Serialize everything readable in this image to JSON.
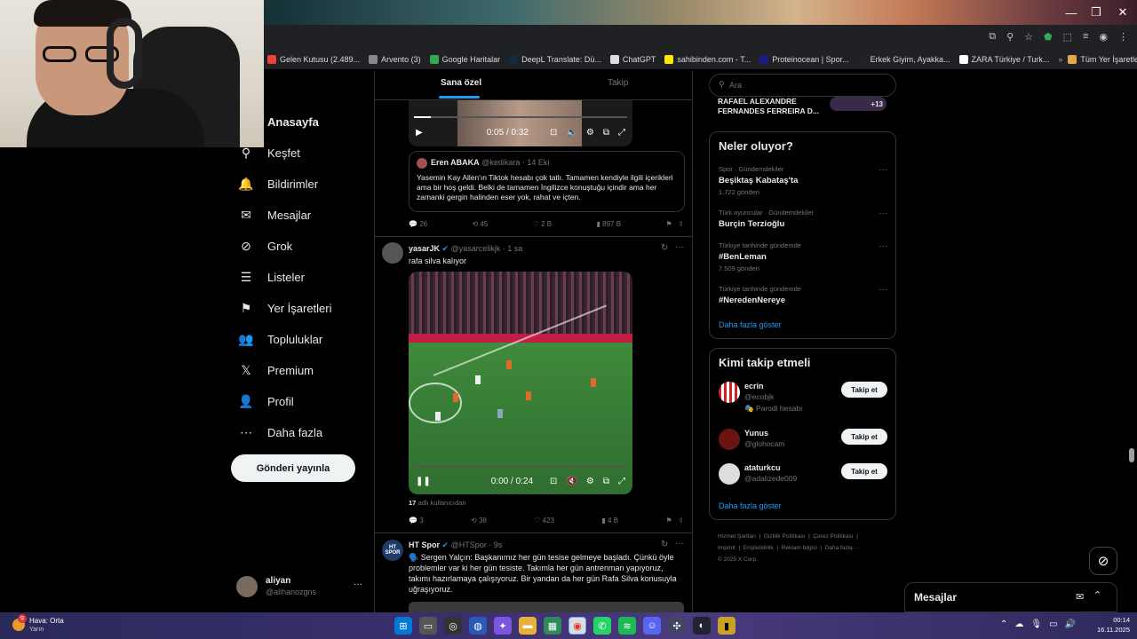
{
  "window": {
    "min": "—",
    "restore": "❐",
    "close": "✕"
  },
  "bookmarks": [
    {
      "label": "Gelen Kutusu (2.489...",
      "color": "#ea4335"
    },
    {
      "label": "Arvento (3)",
      "color": "#888888"
    },
    {
      "label": "Google Haritalar",
      "color": "#34a853"
    },
    {
      "label": "DeepL Translate: Dü...",
      "color": "#0f2b46"
    },
    {
      "label": "ChatGPT",
      "color": "#dddddd"
    },
    {
      "label": "sahibinden.com - T...",
      "color": "#ffe800"
    },
    {
      "label": "Proteinocean | Spor...",
      "color": "#1a1a80"
    },
    {
      "label": "Erkek Giyim, Ayakka...",
      "color": "#222222"
    },
    {
      "label": "ZARA Türkiye / Turk...",
      "color": "#ffffff"
    }
  ],
  "bookmarks_all": "Tüm Yer İşaretleri",
  "nav": {
    "items": [
      {
        "label": "Anasayfa",
        "icon": "home-icon",
        "glyph": "⌂"
      },
      {
        "label": "Keşfet",
        "icon": "search-icon",
        "glyph": "⚲"
      },
      {
        "label": "Bildirimler",
        "icon": "bell-icon",
        "glyph": "🔔"
      },
      {
        "label": "Mesajlar",
        "icon": "mail-icon",
        "glyph": "✉"
      },
      {
        "label": "Grok",
        "icon": "grok-icon",
        "glyph": "⊘"
      },
      {
        "label": "Listeler",
        "icon": "list-icon",
        "glyph": "☰"
      },
      {
        "label": "Yer İşaretleri",
        "icon": "bookmark-icon",
        "glyph": "⚑"
      },
      {
        "label": "Topluluklar",
        "icon": "communities-icon",
        "glyph": "👥"
      },
      {
        "label": "Premium",
        "icon": "x-logo-icon",
        "glyph": "𝕏"
      },
      {
        "label": "Profil",
        "icon": "person-icon",
        "glyph": "👤"
      },
      {
        "label": "Daha fazla",
        "icon": "more-icon",
        "glyph": "⋯"
      }
    ],
    "post_button": "Gönderi yayınla",
    "account": {
      "name": "aliyan",
      "handle": "@alihanozgns",
      "more": "···"
    }
  },
  "feed": {
    "tabs": [
      "Sana özel",
      "Takip"
    ],
    "post1": {
      "video_time": "0:05 / 0:32",
      "quote": {
        "name": "Eren ABAKA",
        "handle": "@kedikara",
        "time": "· 14 Eki",
        "text": "Yasemin Kay Allen'ın Tiktok hesabı çok tatlı. Tamamen kendiyle ilgili içerikleri ama bir hoş geldi. Belki de tamamen İngilizce konuştuğu içindir ama her zamanki gergin halinden eser yok, rahat ve içten."
      },
      "actions": {
        "replies": "26",
        "reposts": "45",
        "likes": "2 B",
        "views": "897 B"
      }
    },
    "post2": {
      "name": "yasarJK",
      "handle": "@yasarcelikjk",
      "time": "· 1 sa",
      "text": "rafa silva kalıyor",
      "video_time": "0:00 / 0:24",
      "views_note_count": "17",
      "views_note": "adlı kullanıcıdan",
      "actions": {
        "replies": "3",
        "reposts": "38",
        "likes": "423",
        "views": "4 B"
      }
    },
    "post3": {
      "name": "HT Spor",
      "handle": "@HTSpor",
      "time": "· 9s",
      "avatar_text": "HT SPOR",
      "text": "🗣️ Sergen Yalçın: Başkanımız her gün tesise gelmeye başladı. Çünkü öyle problemler var ki her gün tesiste. Takımla her gün antrenman yapıyoruz, takımı hazırlamaya çalışıyoruz. Bir yandan da her gün Rafa Silva konusuyla uğraşıyoruz."
    }
  },
  "right": {
    "search_placeholder": "Ara",
    "top_names": "RAFAEL ALEXANDRE FERNANDES FERREIRA D...",
    "top_count": "+13",
    "trends_title": "Neler oluyor?",
    "trends": [
      {
        "cat": "Spor · Gündemdekiler",
        "title": "Beşiktaş Kabataş'ta",
        "count": "1.722 gönderi"
      },
      {
        "cat": "Türk oyuncular · Gündemdekiler",
        "title": "Burçin Terzioğlu",
        "count": ""
      },
      {
        "cat": "Türkiye tarihinde gündemde",
        "title": "#BenLeman",
        "count": "7.509 gönderi"
      },
      {
        "cat": "Türkiye tarihinde gündemde",
        "title": "#NeredenNereye",
        "count": ""
      }
    ],
    "show_more": "Daha fazla göster",
    "who_title": "Kimi takip etmeli",
    "who": [
      {
        "name": "ecrin",
        "handle": "@ecobjk",
        "extra": "Parodi hesabı",
        "btn": "Takip et"
      },
      {
        "name": "Yunus",
        "handle": "@glohocam",
        "extra": "",
        "btn": "Takip et"
      },
      {
        "name": "ataturkcu",
        "handle": "@adalizede009",
        "extra": "",
        "btn": "Takip et"
      }
    ],
    "show_more2": "Daha fazla göster",
    "footer": [
      "Hizmet Şartları",
      "Gizlilik Politikası",
      "Çerez Politikası",
      "Imprint",
      "Erişilebilirlik",
      "Reklam bilgisi",
      "Daha fazla ···",
      "© 2025 X Corp."
    ]
  },
  "messages": {
    "title": "Mesajlar"
  },
  "taskbar": {
    "weather": "Hava: Orta",
    "weather_sub": "Yarın",
    "badge": "9",
    "time": "00:14",
    "date": "16.11.2025"
  }
}
